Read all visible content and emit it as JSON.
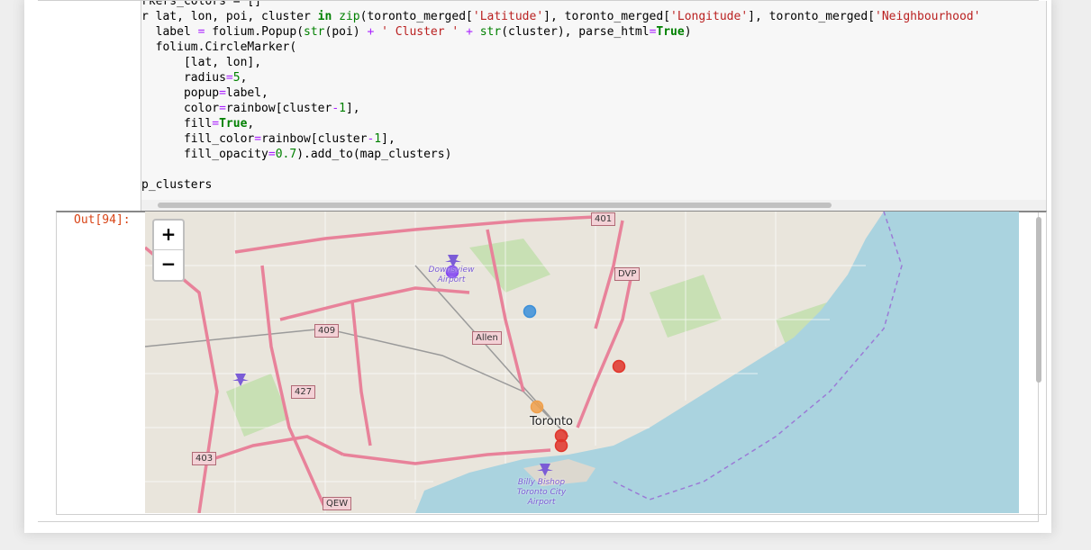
{
  "cell": {
    "code_lines": [
      "rkers_colors = []",
      "r lat, lon, poi, cluster in zip(toronto_merged['Latitude'], toronto_merged['Longitude'], toronto_merged['Neighbourhood'",
      "  label = folium.Popup(str(poi) + ' Cluster ' + str(cluster), parse_html=True)",
      "  folium.CircleMarker(",
      "      [lat, lon],",
      "      radius=5,",
      "      popup=label,",
      "      color=rainbow[cluster-1],",
      "      fill=True,",
      "      fill_color=rainbow[cluster-1],",
      "      fill_opacity=0.7).add_to(map_clusters)",
      "",
      "p_clusters"
    ]
  },
  "output": {
    "prompt": "Out[94]:"
  },
  "map": {
    "zoom_in_label": "+",
    "zoom_out_label": "−",
    "city_label": "Toronto",
    "airport_labels": [
      "Downsview Airport",
      "Billy Bishop Toronto City Airport"
    ],
    "road_shields": [
      "401",
      "409",
      "427",
      "403",
      "QEW",
      "DVP",
      "Allen"
    ],
    "markers": [
      {
        "color": "#7e3ff2"
      },
      {
        "color": "#3b8fd9"
      },
      {
        "color": "#e0342a"
      },
      {
        "color": "#f0a04b"
      },
      {
        "color": "#e0342a"
      },
      {
        "color": "#e0342a"
      }
    ],
    "colors": {
      "water": "#aad3df",
      "land": "#e9e5dc",
      "motorway": "#e8829a",
      "park": "#c8e0b4"
    }
  }
}
